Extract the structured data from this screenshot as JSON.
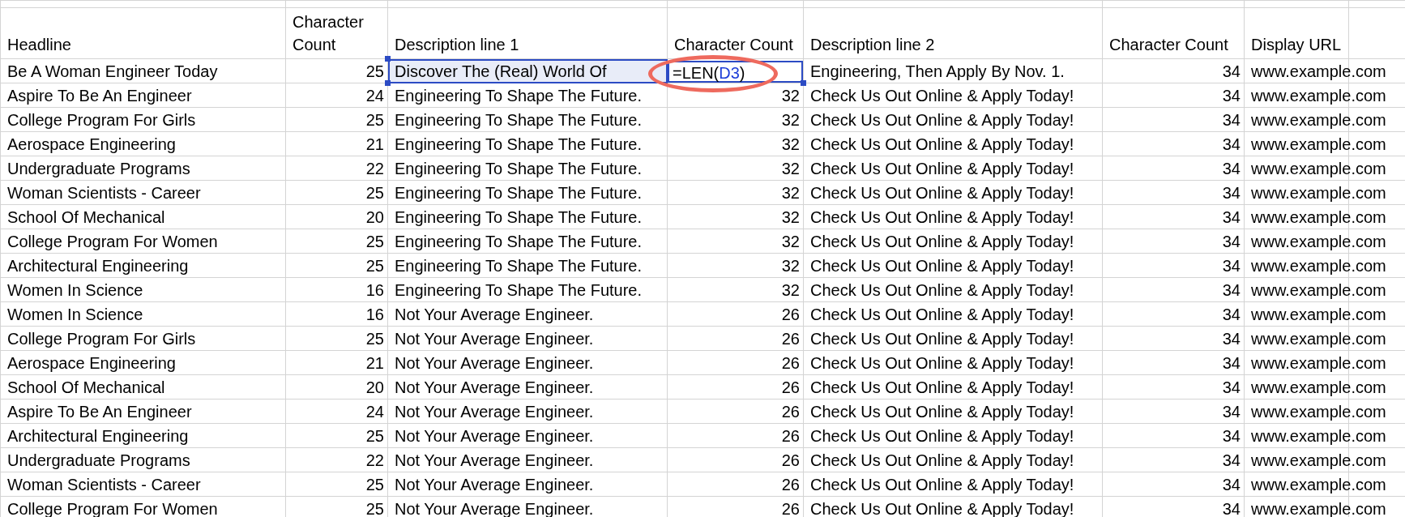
{
  "columns": [
    "Headline",
    "Character Count",
    "Description line 1",
    "Character Count",
    "Description line 2",
    "Character Count",
    "Display URL"
  ],
  "rows": [
    {
      "headline": "Be A Woman Engineer Today",
      "count1": "25",
      "desc1": "Discover The (Real) World Of",
      "desc1_selected": true,
      "formula": {
        "before": "=LEN(",
        "reference": "D3",
        "after": ")"
      },
      "desc2": "Engineering, Then Apply By Nov. 1.",
      "count3": "34",
      "url": "www.example.com"
    },
    {
      "headline": "Aspire To Be An Engineer",
      "count1": "24",
      "desc1": "Engineering To Shape The Future.",
      "desc1_selected": false,
      "count2": "32",
      "desc2": "Check Us Out Online & Apply Today!",
      "count3": "34",
      "url": "www.example.com"
    },
    {
      "headline": "College Program For Girls",
      "count1": "25",
      "desc1": "Engineering To Shape The Future.",
      "desc1_selected": false,
      "count2": "32",
      "desc2": "Check Us Out Online & Apply Today!",
      "count3": "34",
      "url": "www.example.com"
    },
    {
      "headline": "Aerospace Engineering",
      "count1": "21",
      "desc1": "Engineering To Shape The Future.",
      "desc1_selected": false,
      "count2": "32",
      "desc2": "Check Us Out Online & Apply Today!",
      "count3": "34",
      "url": "www.example.com"
    },
    {
      "headline": "Undergraduate Programs",
      "count1": "22",
      "desc1": "Engineering To Shape The Future.",
      "desc1_selected": false,
      "count2": "32",
      "desc2": "Check Us Out Online & Apply Today!",
      "count3": "34",
      "url": "www.example.com"
    },
    {
      "headline": "Woman Scientists - Career",
      "count1": "25",
      "desc1": "Engineering To Shape The Future.",
      "desc1_selected": false,
      "count2": "32",
      "desc2": "Check Us Out Online & Apply Today!",
      "count3": "34",
      "url": "www.example.com"
    },
    {
      "headline": "School Of Mechanical",
      "count1": "20",
      "desc1": "Engineering To Shape The Future.",
      "desc1_selected": false,
      "count2": "32",
      "desc2": "Check Us Out Online & Apply Today!",
      "count3": "34",
      "url": "www.example.com"
    },
    {
      "headline": "College Program For Women",
      "count1": "25",
      "desc1": "Engineering To Shape The Future.",
      "desc1_selected": false,
      "count2": "32",
      "desc2": "Check Us Out Online & Apply Today!",
      "count3": "34",
      "url": "www.example.com"
    },
    {
      "headline": "Architectural Engineering",
      "count1": "25",
      "desc1": "Engineering To Shape The Future.",
      "desc1_selected": false,
      "count2": "32",
      "desc2": "Check Us Out Online & Apply Today!",
      "count3": "34",
      "url": "www.example.com"
    },
    {
      "headline": "Women In Science",
      "count1": "16",
      "desc1": "Engineering To Shape The Future.",
      "desc1_selected": false,
      "count2": "32",
      "desc2": "Check Us Out Online & Apply Today!",
      "count3": "34",
      "url": "www.example.com"
    },
    {
      "headline": "Women In Science",
      "count1": "16",
      "desc1": "Not Your Average Engineer.",
      "desc1_selected": false,
      "count2": "26",
      "desc2": "Check Us Out Online & Apply Today!",
      "count3": "34",
      "url": "www.example.com"
    },
    {
      "headline": "College Program For Girls",
      "count1": "25",
      "desc1": "Not Your Average Engineer.",
      "desc1_selected": false,
      "count2": "26",
      "desc2": "Check Us Out Online & Apply Today!",
      "count3": "34",
      "url": "www.example.com"
    },
    {
      "headline": "Aerospace Engineering",
      "count1": "21",
      "desc1": "Not Your Average Engineer.",
      "desc1_selected": false,
      "count2": "26",
      "desc2": "Check Us Out Online & Apply Today!",
      "count3": "34",
      "url": "www.example.com"
    },
    {
      "headline": "School Of Mechanical",
      "count1": "20",
      "desc1": "Not Your Average Engineer.",
      "desc1_selected": false,
      "count2": "26",
      "desc2": "Check Us Out Online & Apply Today!",
      "count3": "34",
      "url": "www.example.com"
    },
    {
      "headline": "Aspire To Be An Engineer",
      "count1": "24",
      "desc1": "Not Your Average Engineer.",
      "desc1_selected": false,
      "count2": "26",
      "desc2": "Check Us Out Online & Apply Today!",
      "count3": "34",
      "url": "www.example.com"
    },
    {
      "headline": "Architectural Engineering",
      "count1": "25",
      "desc1": "Not Your Average Engineer.",
      "desc1_selected": false,
      "count2": "26",
      "desc2": "Check Us Out Online & Apply Today!",
      "count3": "34",
      "url": "www.example.com"
    },
    {
      "headline": "Undergraduate Programs",
      "count1": "22",
      "desc1": "Not Your Average Engineer.",
      "desc1_selected": false,
      "count2": "26",
      "desc2": "Check Us Out Online & Apply Today!",
      "count3": "34",
      "url": "www.example.com"
    },
    {
      "headline": "Woman Scientists - Career",
      "count1": "25",
      "desc1": "Not Your Average Engineer.",
      "desc1_selected": false,
      "count2": "26",
      "desc2": "Check Us Out Online & Apply Today!",
      "count3": "34",
      "url": "www.example.com"
    },
    {
      "headline": "College Program For Women",
      "count1": "25",
      "desc1": "Not Your Average Engineer.",
      "desc1_selected": false,
      "count2": "26",
      "desc2": "Check Us Out Online & Apply Today!",
      "count3": "34",
      "url": "www.example.com"
    }
  ]
}
